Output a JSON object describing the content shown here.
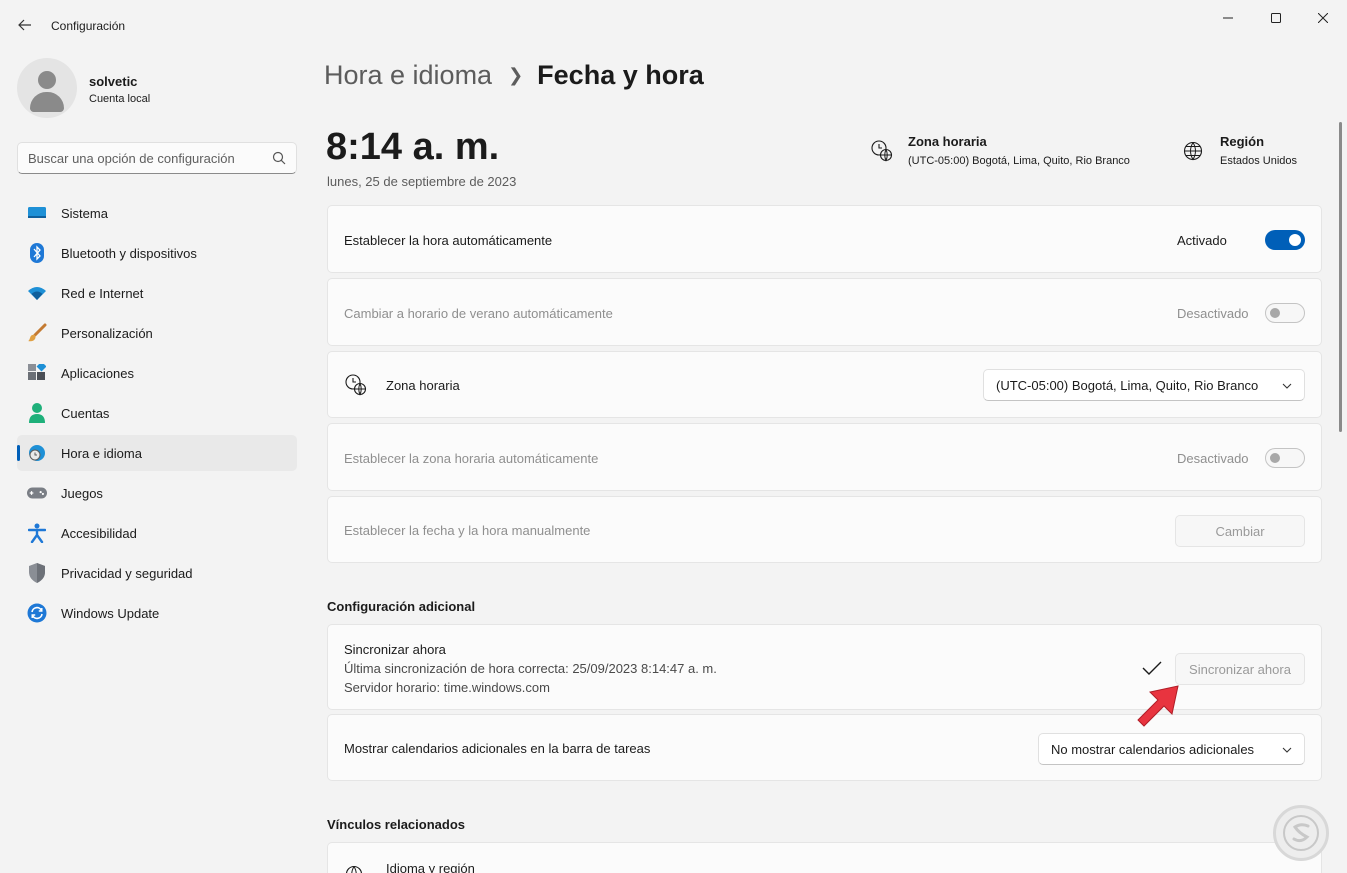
{
  "app": {
    "title": "Configuración"
  },
  "user": {
    "name": "solvetic",
    "account": "Cuenta local"
  },
  "search": {
    "placeholder": "Buscar una opción de configuración"
  },
  "sidebar": {
    "items": [
      {
        "label": "Sistema",
        "icon": "monitor-icon"
      },
      {
        "label": "Bluetooth y dispositivos",
        "icon": "bluetooth-icon"
      },
      {
        "label": "Red e Internet",
        "icon": "wifi-icon"
      },
      {
        "label": "Personalización",
        "icon": "brush-icon"
      },
      {
        "label": "Aplicaciones",
        "icon": "apps-icon"
      },
      {
        "label": "Cuentas",
        "icon": "account-icon"
      },
      {
        "label": "Hora e idioma",
        "icon": "time-language-icon",
        "active": true
      },
      {
        "label": "Juegos",
        "icon": "gamepad-icon"
      },
      {
        "label": "Accesibilidad",
        "icon": "accessibility-icon"
      },
      {
        "label": "Privacidad y seguridad",
        "icon": "shield-icon"
      },
      {
        "label": "Windows Update",
        "icon": "update-icon"
      }
    ]
  },
  "breadcrumb": {
    "parent": "Hora e idioma",
    "current": "Fecha y hora"
  },
  "clock": {
    "time": "8:14 a. m.",
    "date": "lunes, 25 de septiembre de 2023"
  },
  "header_info": {
    "timezone": {
      "title": "Zona horaria",
      "value": "(UTC-05:00) Bogotá, Lima, Quito, Rio Branco"
    },
    "region": {
      "title": "Región",
      "value": "Estados Unidos"
    }
  },
  "settings": {
    "auto_time": {
      "label": "Establecer la hora automáticamente",
      "state": "Activado",
      "on": true
    },
    "dst": {
      "label": "Cambiar a horario de verano automáticamente",
      "state": "Desactivado",
      "on": false,
      "disabled": true
    },
    "timezone": {
      "label": "Zona horaria",
      "value": "(UTC-05:00) Bogotá, Lima, Quito, Rio Branco"
    },
    "auto_timezone": {
      "label": "Establecer la zona horaria automáticamente",
      "state": "Desactivado",
      "on": false,
      "disabled": true
    },
    "manual": {
      "label": "Establecer la fecha y la hora manualmente",
      "button": "Cambiar"
    }
  },
  "additional": {
    "title": "Configuración adicional",
    "sync": {
      "title": "Sincronizar ahora",
      "last_sync": "Última sincronización de hora correcta: 25/09/2023 8:14:47 a. m.",
      "server": "Servidor horario: time.windows.com",
      "button": "Sincronizar ahora"
    },
    "calendars": {
      "label": "Mostrar calendarios adicionales en la barra de tareas",
      "value": "No mostrar calendarios adicionales"
    }
  },
  "related": {
    "title": "Vínculos relacionados",
    "first_item": "Idioma y región"
  },
  "colors": {
    "accent": "#005fb8",
    "background": "#f3f3f3",
    "card": "#fbfbfb",
    "arrow": "#e8343f"
  }
}
